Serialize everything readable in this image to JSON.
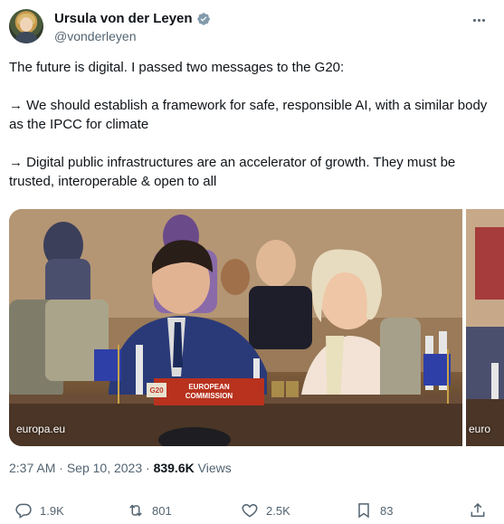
{
  "author": {
    "name": "Ursula von der Leyen",
    "handle": "@vonderleyen"
  },
  "tweet": {
    "paragraphs": [
      "The future is digital. I passed two messages to the G20:",
      "→ We should establish a framework for safe, responsible AI, with a similar body as the IPCC for climate",
      "→ Digital public infrastructures are an accelerator of growth. They must be trusted, interoperable & open to all"
    ]
  },
  "media": {
    "main_source": "europa.eu",
    "side_source": "euro",
    "nameplate_line1": "EUROPEAN",
    "nameplate_line2": "COMMISSION",
    "g20_logo": "G20"
  },
  "meta": {
    "time": "2:37 AM",
    "separator": "·",
    "date": "Sep 10, 2023",
    "views_count": "839.6K",
    "views_label": "Views"
  },
  "actions": {
    "replies": "1.9K",
    "reposts": "801",
    "likes": "2.5K",
    "bookmarks": "83"
  },
  "colors": {
    "text": "#0f1419",
    "secondary": "#536471",
    "verified": "#829aab",
    "nameplate": "#b8321e"
  }
}
